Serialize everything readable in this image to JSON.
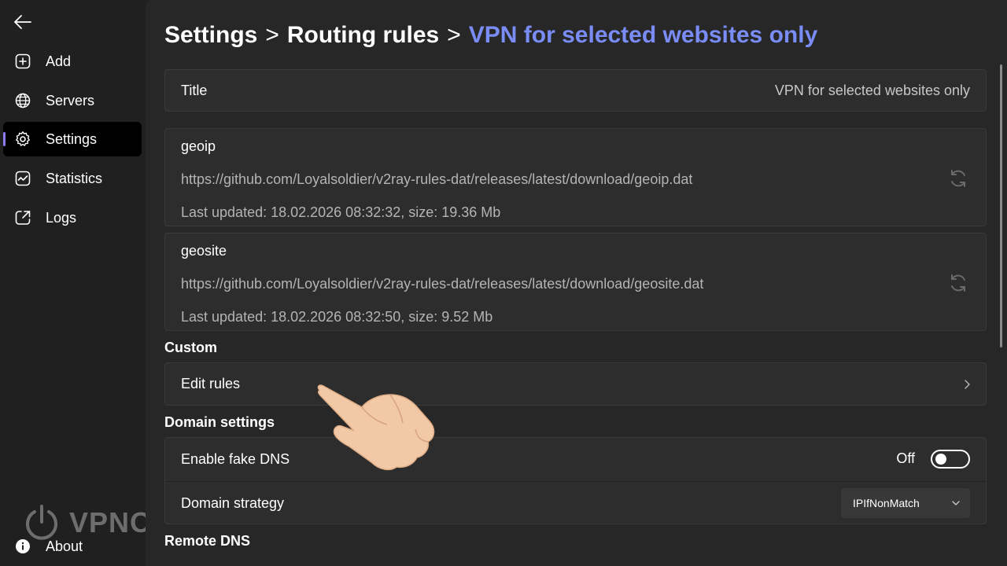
{
  "sidebar": {
    "back_icon": "arrow-left-icon",
    "items": [
      {
        "label": "Add",
        "icon": "plus-square-icon",
        "active": false
      },
      {
        "label": "Servers",
        "icon": "globe-icon",
        "active": false
      },
      {
        "label": "Settings",
        "icon": "gear-icon",
        "active": true
      },
      {
        "label": "Statistics",
        "icon": "chart-icon",
        "active": false
      },
      {
        "label": "Logs",
        "icon": "log-icon",
        "active": false
      }
    ],
    "about": {
      "label": "About",
      "icon": "info-icon"
    },
    "watermark": "VPNON"
  },
  "breadcrumb": {
    "part1": "Settings",
    "sep1": ">",
    "part2": "Routing rules",
    "sep2": ">",
    "current": "VPN for selected websites only"
  },
  "title_row": {
    "label": "Title",
    "value": "VPN for selected websites only"
  },
  "geoip": {
    "name": "geoip",
    "url": "https://github.com/Loyalsoldier/v2ray-rules-dat/releases/latest/download/geoip.dat",
    "updated": "Last updated: 18.02.2026 08:32:32, size: 19.36 Mb"
  },
  "geosite": {
    "name": "geosite",
    "url": "https://github.com/Loyalsoldier/v2ray-rules-dat/releases/latest/download/geosite.dat",
    "updated": "Last updated: 18.02.2026 08:32:50, size: 9.52 Mb"
  },
  "custom": {
    "section_title": "Custom",
    "edit_rules_label": "Edit rules"
  },
  "domain_settings": {
    "section_title": "Domain settings",
    "fake_dns_label": "Enable fake DNS",
    "fake_dns_state": "Off",
    "strategy_label": "Domain strategy",
    "strategy_value": "IPIfNonMatch"
  },
  "remote_dns": {
    "section_title": "Remote DNS"
  },
  "colors": {
    "accent": "#7a8cf5",
    "active_indicator": "#8b7cf6",
    "background": "#202020",
    "card": "#2d2d2d"
  }
}
